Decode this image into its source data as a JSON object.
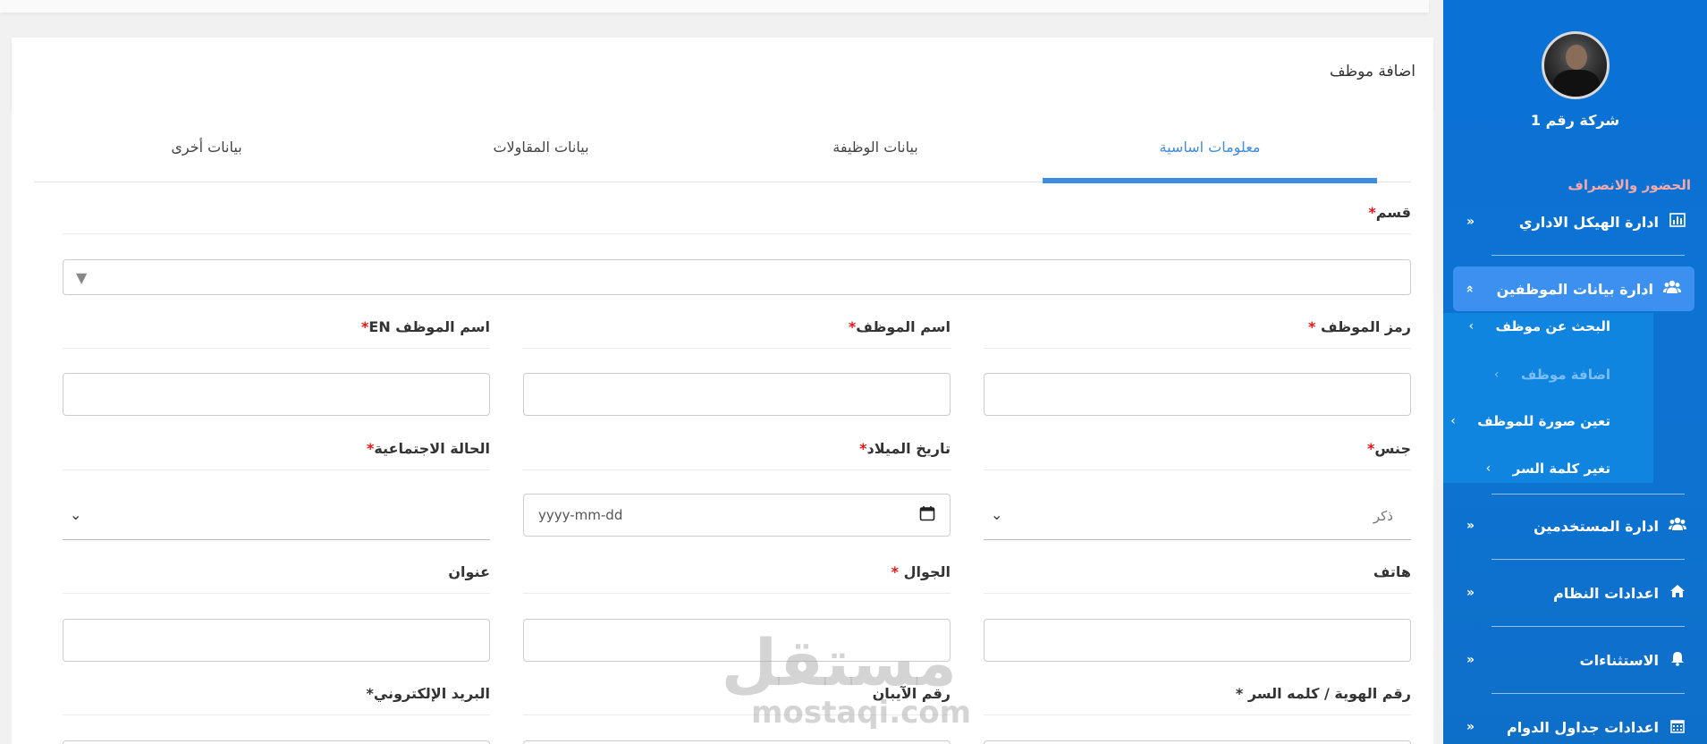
{
  "sidebar": {
    "company_name": "شركة رقم 1",
    "section_label": "الحضور والانصراف",
    "items": [
      {
        "label": "ادارة الهيكل الاداري",
        "icon": "chart-bar-icon",
        "chevron": "«"
      },
      {
        "label": "ادارة بيانات الموظفين",
        "icon": "users-icon",
        "chevron": "»"
      },
      {
        "label": "ادارة المستخدمين",
        "icon": "users-icon",
        "chevron": "«"
      },
      {
        "label": "اعدادات النظام",
        "icon": "home-icon",
        "chevron": "«"
      },
      {
        "label": "الاستثناءات",
        "icon": "bell-icon",
        "chevron": "«"
      },
      {
        "label": "اعدادات جداول الدوام",
        "icon": "calendar-icon",
        "chevron": "«"
      }
    ],
    "submenu": [
      {
        "label": "البحث عن موظف",
        "chevron": "›"
      },
      {
        "label": "اضافة موظف",
        "chevron": "›"
      },
      {
        "label": "تعين صورة للموظف",
        "chevron": "›"
      },
      {
        "label": "تغير كلمة السر",
        "chevron": "›"
      }
    ]
  },
  "header": {
    "title": "اضافة موظف"
  },
  "tabs": [
    "معلومات اساسية",
    "بيانات الوظيفة",
    "بيانات المقاولات",
    "بيانات أخرى"
  ],
  "form": {
    "required_mark": "*",
    "department": {
      "label": "قسم",
      "caret": "▼"
    },
    "employee_code": {
      "label": "رمز الموظف "
    },
    "employee_name": {
      "label": "اسم الموظف"
    },
    "employee_name_en": {
      "label": "اسم الموظف EN"
    },
    "gender": {
      "label": "جنس",
      "value": "ذكر",
      "caret": "⌄"
    },
    "birth_date": {
      "label": "تاريخ الميلاد",
      "placeholder": "yyyy-mm-dd"
    },
    "marital_status": {
      "label": "الحالة الاجتماعية",
      "caret": "⌄"
    },
    "phone": {
      "label": "هاتف"
    },
    "mobile": {
      "label": "الجوال "
    },
    "address": {
      "label": "عنوان"
    },
    "id_password": {
      "label": "رقم الهوية / كلمه السر *"
    },
    "iban": {
      "label": "رقم الآيبان"
    },
    "email": {
      "label": "البريد الإلكتروني*"
    }
  },
  "watermark": {
    "arabic": "مستقل",
    "latin": "mostaqi.com"
  },
  "colors": {
    "sidebar": "#0a72d6",
    "active_item": "#3c91f0",
    "tab_active": "#3d8ce0",
    "required": "#e11111"
  }
}
